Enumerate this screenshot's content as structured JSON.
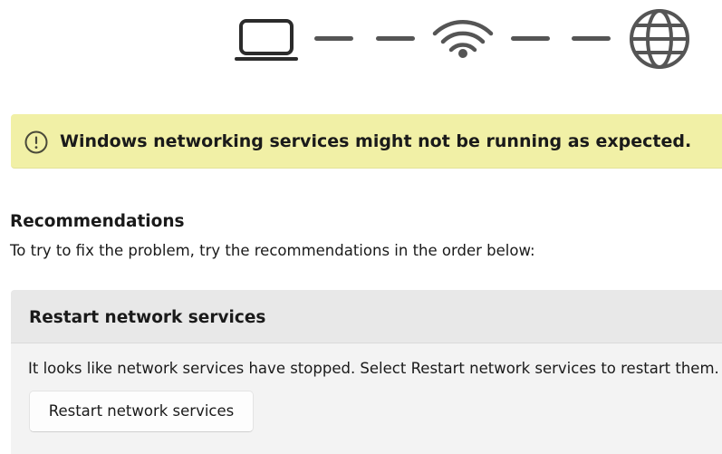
{
  "diagram": {
    "nodes": [
      "laptop-icon",
      "wifi-icon",
      "globe-icon"
    ],
    "link_color": "#555555"
  },
  "banner": {
    "icon": "warning-circle-icon",
    "text": "Windows networking services might not be running as expected.",
    "background": "#f1f0a6"
  },
  "recommendations": {
    "title": "Recommendations",
    "description": "To try to fix the problem, try the recommendations in the order below:"
  },
  "card": {
    "title": "Restart network services",
    "body": "It looks like network services have stopped. Select Restart network services to restart them.",
    "button_label": "Restart network services"
  }
}
